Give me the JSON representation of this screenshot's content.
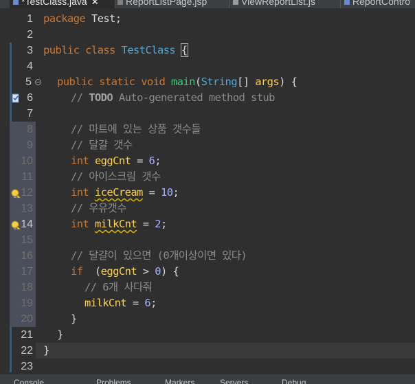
{
  "tabs": [
    {
      "label": "*TestClass.java",
      "active": true,
      "icon": "java-file-icon"
    },
    {
      "label": "ReportListPage.jsp",
      "active": false,
      "icon": "jsp-file-icon"
    },
    {
      "label": "ViewReportList.js",
      "active": false,
      "icon": "js-file-icon"
    },
    {
      "label": "ReportContro",
      "active": false,
      "icon": "java-file-icon"
    }
  ],
  "tab_close": "✕",
  "line_numbers": [
    "1",
    "2",
    "3",
    "4",
    "5",
    "6",
    "7",
    "8",
    "9",
    "10",
    "11",
    "12",
    "13",
    "14",
    "15",
    "16",
    "17",
    "18",
    "19",
    "20",
    "21",
    "22",
    "23"
  ],
  "code": {
    "l1": {
      "kw": "package",
      "rest": " Test;"
    },
    "l3": {
      "kw": "public class",
      "cls": "TestClass",
      "brace": "{"
    },
    "l5": {
      "kw": "public static void",
      "method": "main",
      "paren": "(",
      "type": "String",
      "rest": "[] ",
      "param": "args",
      "close": ") {"
    },
    "l6": {
      "slash": "// ",
      "todo": "TODO",
      "text": " Auto-generated method stub"
    },
    "l8": "// 마트에 있는 상품 갯수들",
    "l9": "// 달걀 갯수",
    "l10": {
      "kw": "int",
      "var": "eggCnt",
      "eq": " = ",
      "num": "6",
      "semi": ";"
    },
    "l11": "// 아이스크림 갯수",
    "l12": {
      "kw": "int",
      "var": "iceCream",
      "eq": " = ",
      "num": "10",
      "semi": ";"
    },
    "l13": "// 우유갯수",
    "l14": {
      "kw": "int",
      "var": "milkCnt",
      "eq": " = ",
      "num": "2",
      "semi": ";"
    },
    "l16": "// 달걀이 있으면 (0개이상이면 있다)",
    "l17": {
      "kw": "if",
      "open": "  (",
      "var": "eggCnt",
      "op": " > ",
      "num": "0",
      "close": ") {"
    },
    "l18": "// 6개 사다줘",
    "l19": {
      "var": "milkCnt",
      "eq": " = ",
      "num": "6",
      "semi": ";"
    },
    "l20": "}",
    "l21": "}",
    "l22": "}"
  },
  "bottom_tabs": [
    "Console",
    "Problems",
    "Markers",
    "Servers",
    "Debug"
  ],
  "colors": {
    "background": "#2f2f2f",
    "keyword": "#cc7832",
    "class": "#4fa6d8",
    "method": "#3ec97b",
    "variable": "#ffd24a",
    "number": "#a0b4ff",
    "comment": "#8b8b8b"
  }
}
